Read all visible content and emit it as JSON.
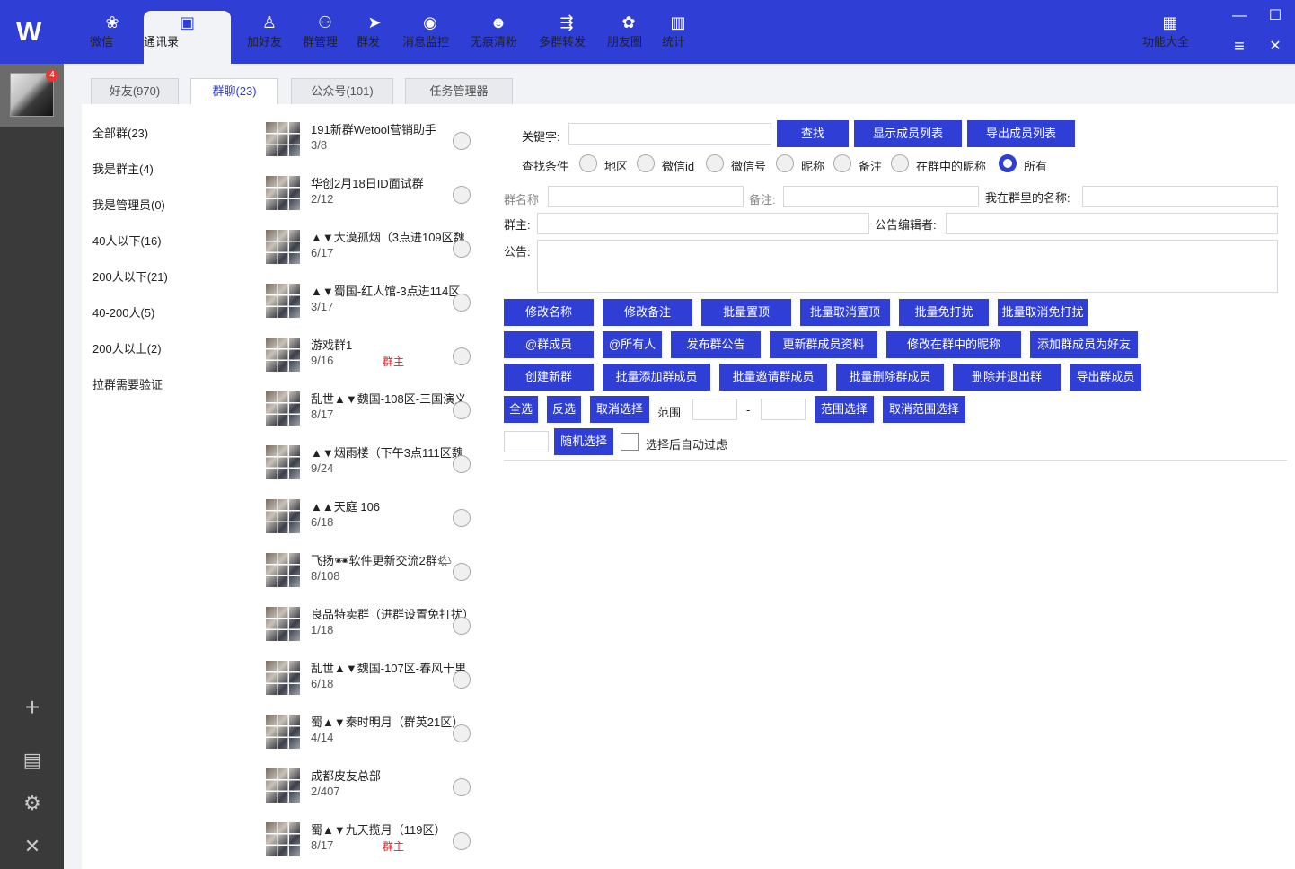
{
  "app": {
    "logo": "W"
  },
  "nav": [
    {
      "label": "微信",
      "icon": "wechat-icon",
      "glyph": "❀"
    },
    {
      "label": "通讯录",
      "icon": "contacts-icon",
      "glyph": "▣"
    },
    {
      "label": "加好友",
      "icon": "add-friend-icon",
      "glyph": "♙"
    },
    {
      "label": "群管理",
      "icon": "group-manage-icon",
      "glyph": "⚇"
    },
    {
      "label": "群发",
      "icon": "mass-send-icon",
      "glyph": "➤"
    },
    {
      "label": "消息监控",
      "icon": "eye-icon",
      "glyph": "◉"
    },
    {
      "label": "无痕清粉",
      "icon": "ghost-icon",
      "glyph": "☻"
    },
    {
      "label": "多群转发",
      "icon": "forward-icon",
      "glyph": "⇶"
    },
    {
      "label": "朋友圈",
      "icon": "moments-icon",
      "glyph": "✿"
    },
    {
      "label": "统计",
      "icon": "stats-icon",
      "glyph": "▥"
    }
  ],
  "features": {
    "label": "功能大全",
    "glyph": "▦"
  },
  "window": {
    "minimize": "—",
    "maximize": "☐",
    "menu": "≡",
    "close": "✕"
  },
  "sidebar": {
    "badge": "4",
    "add": "+",
    "card": "▤",
    "settings": "⚙",
    "close": "✕"
  },
  "tabs": [
    "好友(970)",
    "群聊(23)",
    "公众号(101)",
    "任务管理器"
  ],
  "categories": [
    "全部群(23)",
    "我是群主(4)",
    "我是管理员(0)",
    "40人以下(16)",
    "200人以下(21)",
    "40-200人(5)",
    "200人以上(2)",
    "拉群需要验证"
  ],
  "groups": [
    {
      "name": "191新群Wetool营销助手",
      "count": "3/8",
      "owner": ""
    },
    {
      "name": "华创2月18日ID面试群",
      "count": "2/12",
      "owner": ""
    },
    {
      "name": "▲▼大漠孤烟（3点进109区魏",
      "count": "6/17",
      "owner": ""
    },
    {
      "name": "▲▼蜀国-红人馆-3点进114区",
      "count": "3/17",
      "owner": ""
    },
    {
      "name": "游戏群1",
      "count": "9/16",
      "owner": "群主"
    },
    {
      "name": "乱世▲▼魏国-108区-三国演义",
      "count": "8/17",
      "owner": ""
    },
    {
      "name": "▲▼烟雨楼（下午3点111区魏",
      "count": "9/24",
      "owner": ""
    },
    {
      "name": "▲▲天庭 106",
      "count": "6/18",
      "owner": ""
    },
    {
      "name": "飞扬🕶软件更新交流2群🌤",
      "count": "8/108",
      "owner": ""
    },
    {
      "name": "良品特卖群（进群设置免打扰）",
      "count": "1/18",
      "owner": ""
    },
    {
      "name": "乱世▲▼魏国-107区-春风十里",
      "count": "6/18",
      "owner": ""
    },
    {
      "name": "蜀▲▼秦时明月（群英21区）",
      "count": "4/14",
      "owner": ""
    },
    {
      "name": "成都皮友总部",
      "count": "2/407",
      "owner": ""
    },
    {
      "name": "蜀▲▼九天揽月（119区）",
      "count": "8/17",
      "owner": "群主"
    }
  ],
  "search": {
    "keyword_label": "关键字:",
    "keyword_value": "",
    "find": "查找",
    "show_members": "显示成员列表",
    "export_members": "导出成员列表",
    "condition_label": "查找条件",
    "conditions": [
      "地区",
      "微信id",
      "微信号",
      "昵称",
      "备注",
      "在群中的昵称",
      "所有"
    ],
    "selected_condition": "所有"
  },
  "info": {
    "group_name_label": "群名称",
    "remark_label": "备注:",
    "my_name_label": "我在群里的名称:",
    "owner_label": "群主:",
    "notice_editor_label": "公告编辑者:",
    "notice_label": "公告:"
  },
  "actions": {
    "row1": [
      "修改名称",
      "修改备注",
      "批量置顶",
      "批量取消置顶",
      "批量免打扰",
      "批量取消免打扰"
    ],
    "row2": [
      "@群成员",
      "@所有人",
      "发布群公告",
      "更新群成员资料",
      "修改在群中的昵称",
      "添加群成员为好友"
    ],
    "row3": [
      "创建新群",
      "批量添加群成员",
      "批量邀请群成员",
      "批量删除群成员",
      "删除并退出群",
      "导出群成员"
    ],
    "row4": [
      "全选",
      "反选",
      "取消选择"
    ],
    "range_label": "范围",
    "range_dash": "-",
    "range_select": "范围选择",
    "cancel_range": "取消范围选择",
    "random_select": "随机选择",
    "auto_filter_label": "选择后自动过虑"
  }
}
